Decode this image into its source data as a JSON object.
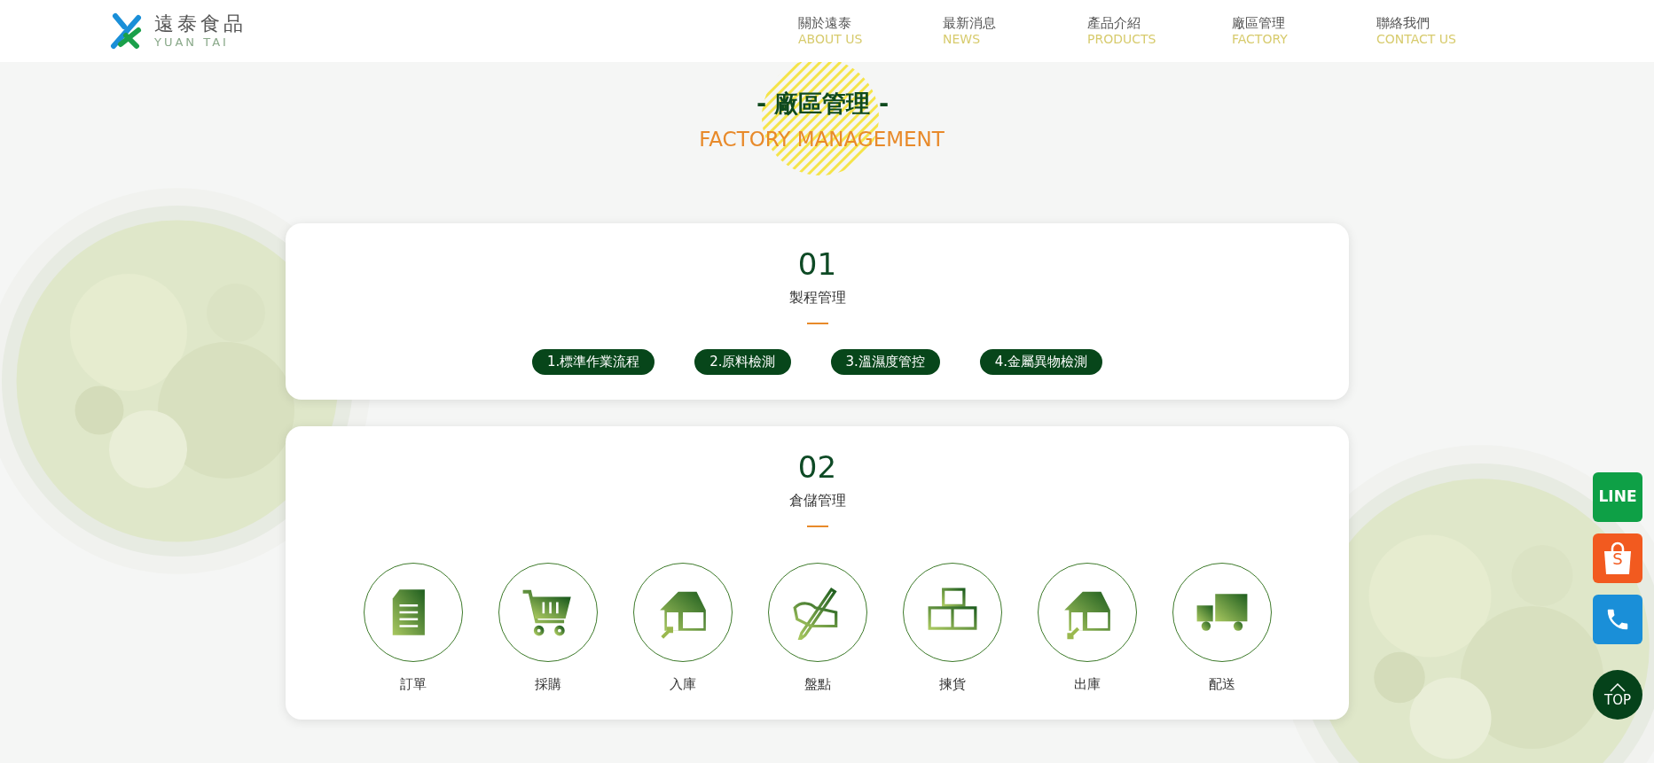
{
  "logo": {
    "name": "遠泰食品",
    "subtitle": "YUAN TAI"
  },
  "nav": [
    {
      "label": "關於遠泰",
      "sublabel": "ABOUT US"
    },
    {
      "label": "最新消息",
      "sublabel": "NEWS"
    },
    {
      "label": "產品介紹",
      "sublabel": "PRODUCTS"
    },
    {
      "label": "廠區管理",
      "sublabel": "FACTORY"
    },
    {
      "label": "聯絡我們",
      "sublabel": "CONTACT US"
    }
  ],
  "heading": {
    "title": "- 廠區管理 -",
    "subtitle": "FACTORY MANAGEMENT"
  },
  "sections": [
    {
      "number": "01",
      "title": "製程管理",
      "kind": "tags",
      "items": [
        {
          "label": "1.標準作業流程"
        },
        {
          "label": "2.原料檢測"
        },
        {
          "label": "3.溫濕度管控"
        },
        {
          "label": "4.金屬異物檢測"
        }
      ]
    },
    {
      "number": "02",
      "title": "倉儲管理",
      "kind": "steps",
      "items": [
        {
          "label": "訂單"
        },
        {
          "label": "採購"
        },
        {
          "label": "入庫"
        },
        {
          "label": "盤點"
        },
        {
          "label": "揀貨"
        },
        {
          "label": "出庫"
        },
        {
          "label": "配送"
        }
      ]
    }
  ],
  "side_buttons": [
    {
      "kind": "line",
      "label": "LINE"
    },
    {
      "kind": "shop",
      "label": "S"
    },
    {
      "kind": "phone"
    },
    {
      "kind": "top",
      "label": "TOP"
    }
  ]
}
